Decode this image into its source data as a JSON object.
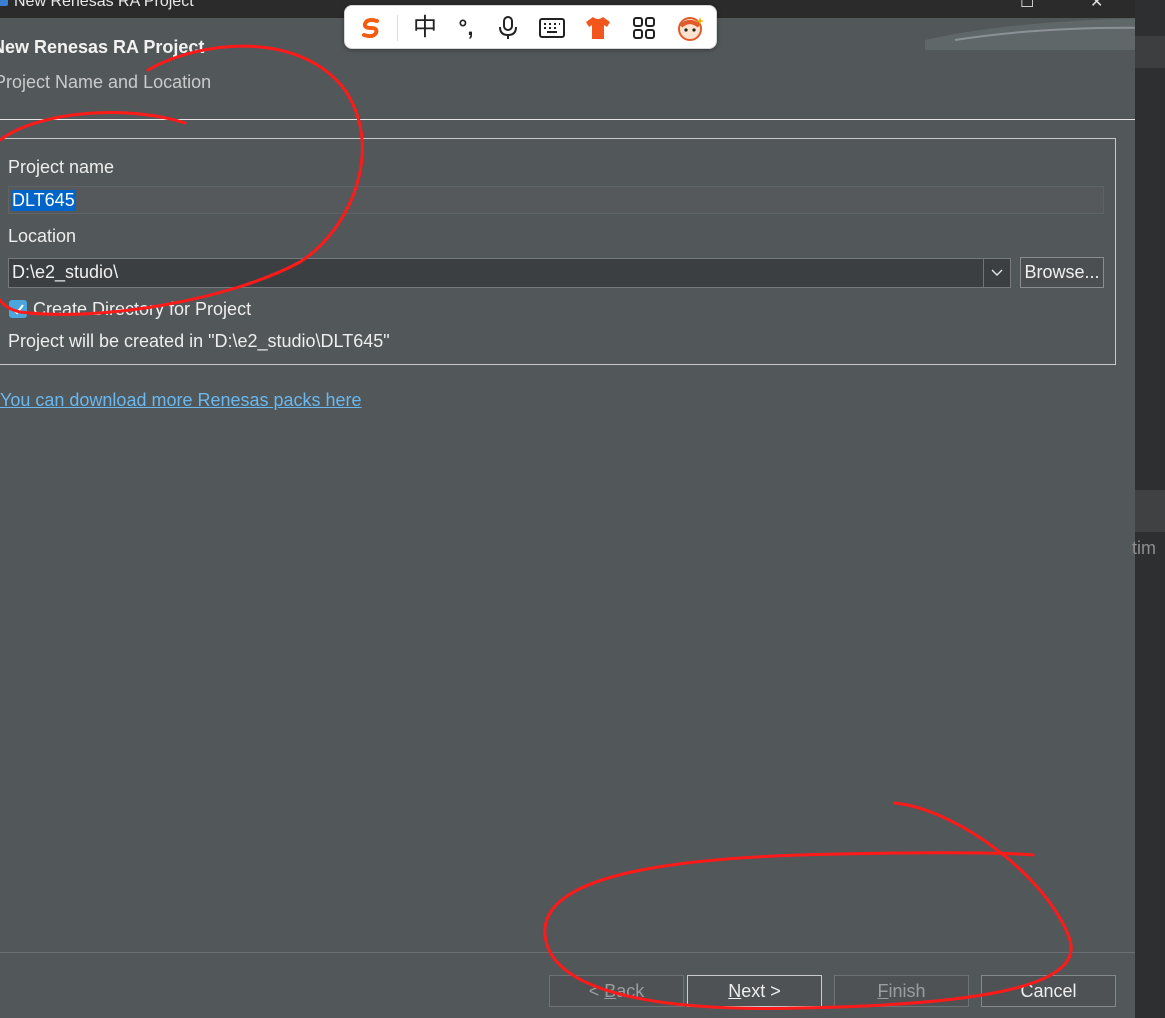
{
  "window": {
    "title": "New Renesas RA Project"
  },
  "header": {
    "title": "New Renesas RA Project",
    "subtitle": "Project Name and Location"
  },
  "form": {
    "project_name_label": "Project name",
    "project_name_value": "DLT645",
    "location_label": "Location",
    "location_value": "D:\\e2_studio\\",
    "browse_label": "Browse...",
    "create_dir_label": "Create Directory for Project",
    "create_dir_checked": true,
    "info_text": "Project will be created in \"D:\\e2_studio\\DLT645\""
  },
  "link": {
    "text": "You can download more Renesas packs here"
  },
  "buttons": {
    "back": {
      "pre": "< ",
      "mnemonic": "B",
      "rest": "ack",
      "enabled": false
    },
    "next": {
      "mnemonic": "N",
      "rest": "ext >",
      "enabled": true
    },
    "finish": {
      "mnemonic": "F",
      "rest": "inish",
      "enabled": false
    },
    "cancel": {
      "label": "Cancel",
      "enabled": true
    }
  },
  "background": {
    "right_edge_text": "tim"
  },
  "ime_toolbar": {
    "logo_icon": "sogou-logo-icon",
    "mode_label": "中",
    "punctuation_label": "°,",
    "mic_icon": "microphone-icon",
    "keyboard_icon": "keyboard-icon",
    "skin_icon": "skin-shirt-icon",
    "tools_icon": "toolbox-grid-icon",
    "mascot_icon": "mascot-icon"
  },
  "annotations": {
    "color": "#ff1a1a",
    "style": "hand-drawn circles"
  },
  "colors": {
    "dialog_bg": "#525759",
    "selection_bg": "#0064c8",
    "link": "#6ab8ef",
    "checkbox": "#4aa6dc"
  }
}
